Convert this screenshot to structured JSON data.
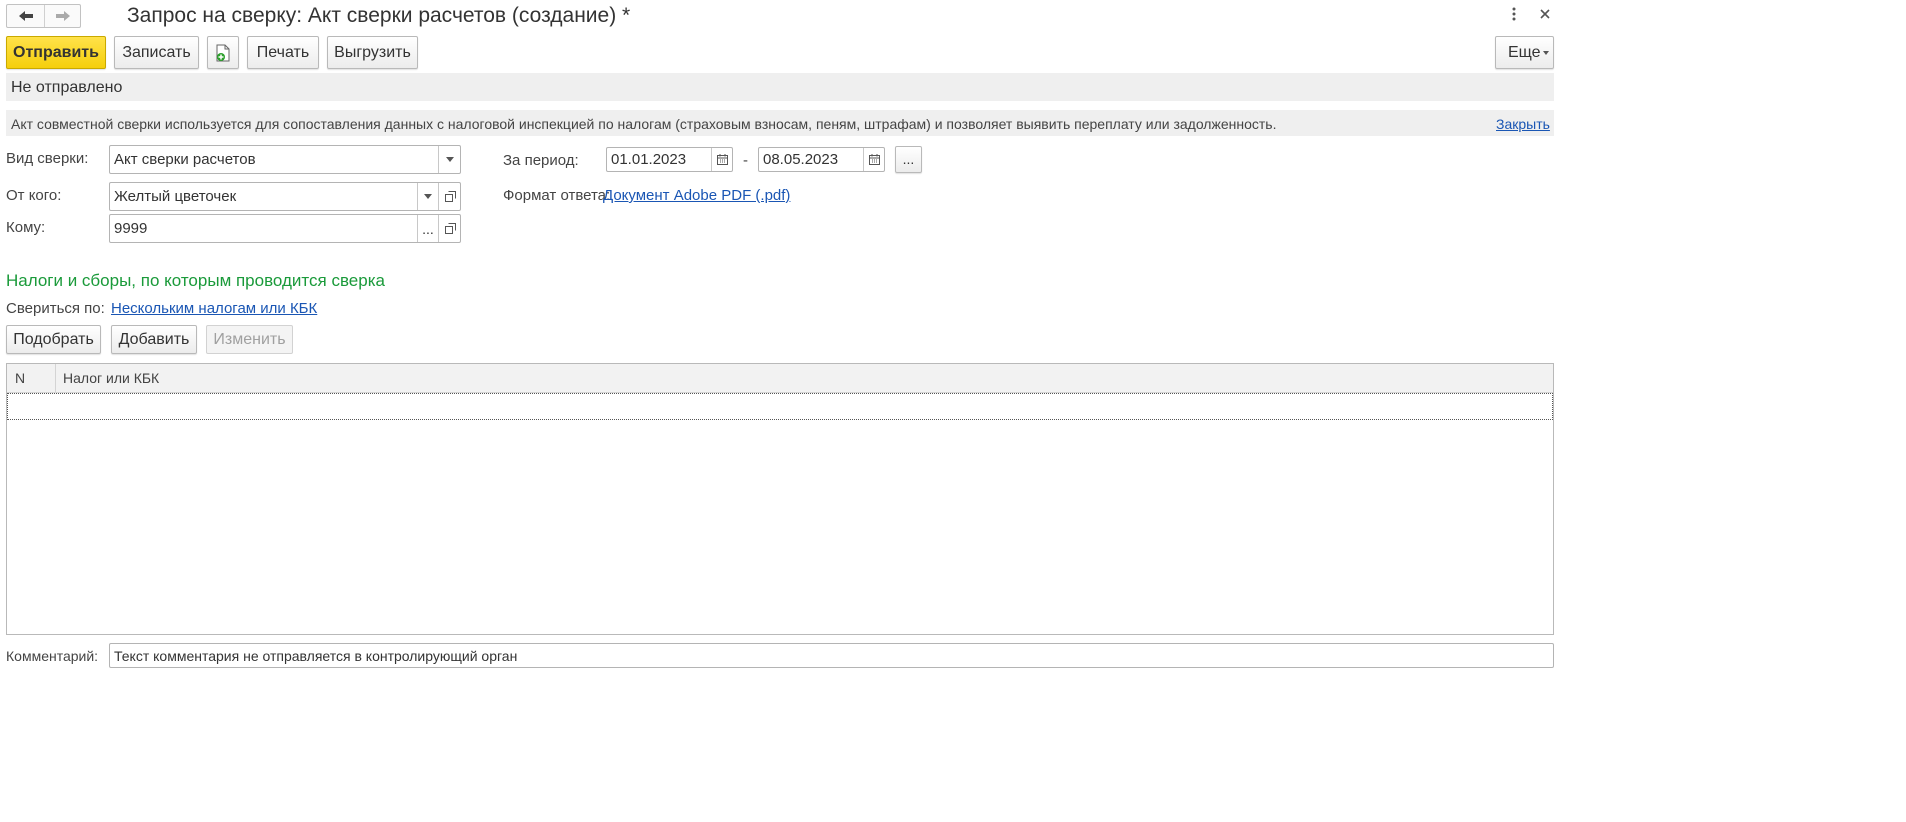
{
  "window": {
    "title": "Запрос на сверку: Акт сверки расчетов (создание) *"
  },
  "toolbar": {
    "send": "Отправить",
    "save": "Записать",
    "print": "Печать",
    "export": "Выгрузить",
    "more": "Еще"
  },
  "status": {
    "text": "Не отправлено"
  },
  "info": {
    "text": "Акт совместной сверки используется для сопоставления данных с налоговой инспекцией по налогам (страховым взносам, пеням, штрафам) и позволяет выявить переплату или задолженность.",
    "close_link": "Закрыть"
  },
  "form": {
    "kind_label": "Вид сверки:",
    "kind_value": "Акт сверки расчетов",
    "from_label": "От кого:",
    "from_value": "Желтый цветочек",
    "to_label": "Кому:",
    "to_value": "9999",
    "period_label": "За период:",
    "period_from": "01.01.2023",
    "period_dash": "-",
    "period_to": "08.05.2023",
    "period_more": "...",
    "format_label": "Формат ответа:",
    "format_value": "Документ Adobe PDF (.pdf)",
    "choose_button": "..."
  },
  "taxes_section": {
    "heading": "Налоги и сборы, по которым проводится сверка",
    "reconcile_by_label": "Свериться по:",
    "reconcile_by_value": "Нескольким налогам или КБК",
    "pick_button": "Подобрать",
    "add_button": "Добавить",
    "edit_button": "Изменить",
    "table": {
      "columns": [
        "N",
        "Налог или КБК"
      ],
      "rows": []
    }
  },
  "comment": {
    "label": "Комментарий:",
    "placeholder": "Текст комментария не отправляется в контролирующий орган"
  },
  "colors": {
    "accent_yellow": "#f5cf0c",
    "heading_green": "#1a9a3a",
    "link_blue": "#1a56b4",
    "panel_gray": "#efefef"
  }
}
